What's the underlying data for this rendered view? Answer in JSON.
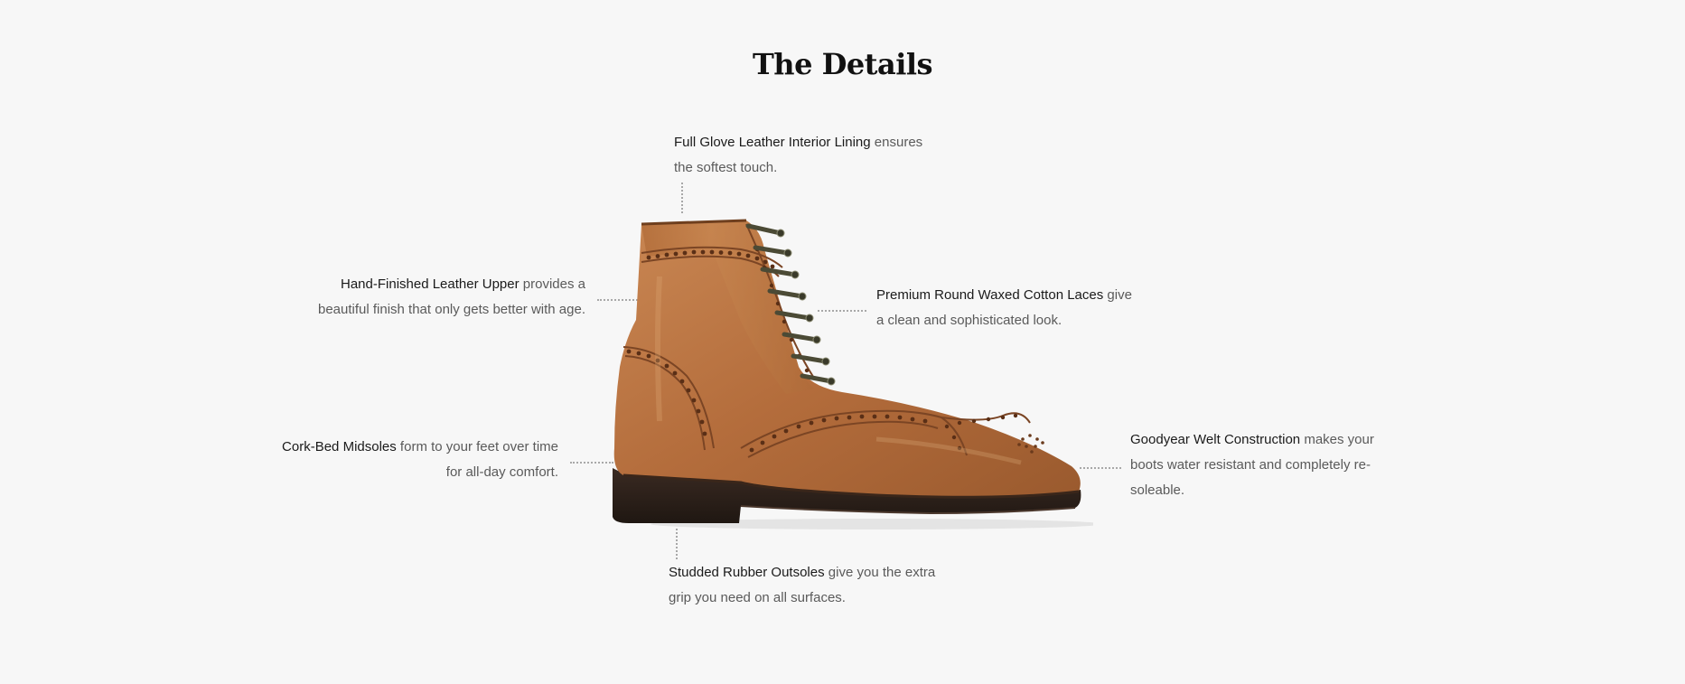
{
  "section": {
    "title": "The Details"
  },
  "callouts": {
    "lining": {
      "lead": "Full Glove Leather Interior Lining",
      "text": " ensures the softest touch."
    },
    "upper": {
      "lead": "Hand-Finished Leather Upper",
      "text": " provides a beautiful finish that only gets better with age."
    },
    "laces": {
      "lead": "Premium Round Waxed Cotton Laces",
      "text": " give a clean and sophisticated look."
    },
    "midsoles": {
      "lead": "Cork-Bed Midsoles",
      "text": " form to your feet over time for all-day comfort."
    },
    "welt": {
      "lead": "Goodyear Welt Construction",
      "text": " makes your boots water resistant and completely re-soleable."
    },
    "outsoles": {
      "lead": "Studded Rubber Outsoles",
      "text": " give you the extra grip you need on all surfaces."
    }
  },
  "colors": {
    "background": "#f7f7f7",
    "leather": "#b8703f",
    "sole": "#2e221c"
  },
  "image": {
    "subject": "brown leather wingtip brogue lace-up boot"
  }
}
